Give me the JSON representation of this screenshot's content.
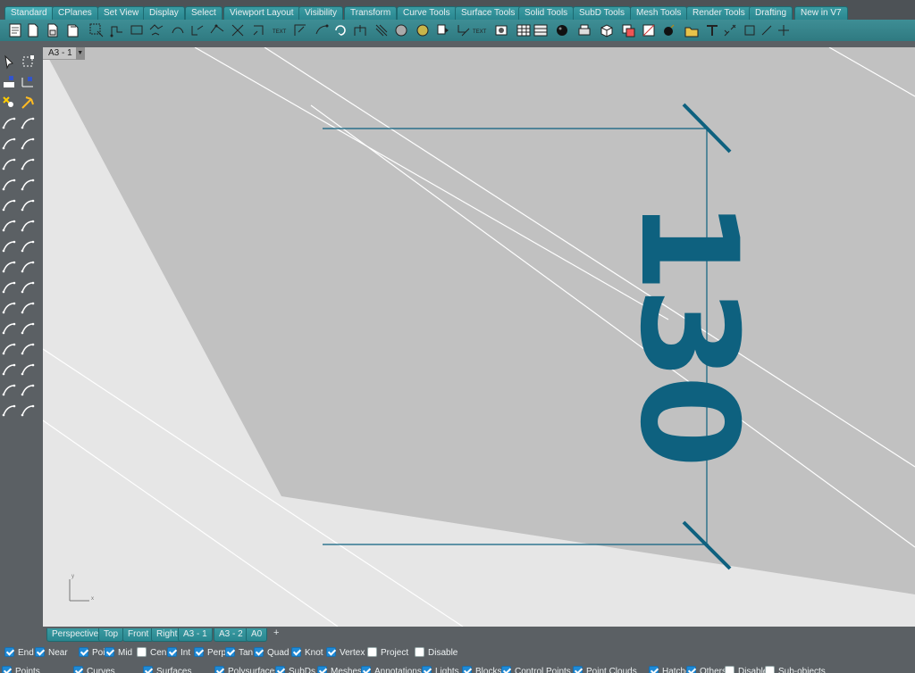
{
  "top_tabs": [
    {
      "label": "Standard",
      "active": true
    },
    {
      "label": "CPlanes"
    },
    {
      "label": "Set View"
    },
    {
      "label": "Display"
    },
    {
      "label": "Select"
    },
    {
      "label": "Viewport Layout"
    },
    {
      "label": "Visibility"
    },
    {
      "label": "Transform"
    },
    {
      "label": "Curve Tools"
    },
    {
      "label": "Surface Tools"
    },
    {
      "label": "Solid Tools"
    },
    {
      "label": "SubD Tools"
    },
    {
      "label": "Mesh Tools"
    },
    {
      "label": "Render Tools"
    },
    {
      "label": "Drafting"
    },
    {
      "label": "New in V7"
    }
  ],
  "toolbar_icons": [
    "new-icon",
    "open-icon",
    "save-icon",
    "save-as-icon",
    "print-icon",
    "select-window-icon",
    "polyline-icon",
    "rectangle-icon",
    "polygon-icon",
    "curve-icon",
    "arc-icon",
    "move-icon",
    "rotate-icon",
    "mirror-icon",
    "array-icon",
    "text-icon",
    "dimension-icon",
    "leader-icon",
    "undo-icon",
    "redo-icon",
    "hatch-icon",
    "layer-icon",
    "properties-icon",
    "trim-icon",
    "split-icon",
    "text-object-icon",
    "snapshot-icon",
    "grid-icon",
    "layer-table-icon",
    "sphere-icon",
    "printer-icon",
    "box-icon",
    "mesh-icon",
    "render-icon",
    "material-icon",
    "bomb-icon",
    "folder-icon",
    "text-dot-icon",
    "transform-icon"
  ],
  "viewport": {
    "title": "A3 - 1",
    "dimension_text": "130",
    "axis_y": "y",
    "axis_x": "x",
    "accent_color": "#0e617f"
  },
  "viewport_tabs": [
    "Perspective",
    "Top",
    "Front",
    "Right",
    "A3 - 1",
    "A3 - 2",
    "A0"
  ],
  "add_tab_label": "+",
  "osnaps": [
    {
      "label": "End",
      "checked": true
    },
    {
      "label": "Near",
      "checked": true
    },
    {
      "label": "Point",
      "checked": true
    },
    {
      "label": "Mid",
      "checked": true
    },
    {
      "label": "Cen",
      "checked": false
    },
    {
      "label": "Int",
      "checked": true
    },
    {
      "label": "Perp",
      "checked": true
    },
    {
      "label": "Tan",
      "checked": true
    },
    {
      "label": "Quad",
      "checked": true
    },
    {
      "label": "Knot",
      "checked": true
    },
    {
      "label": "Vertex",
      "checked": true
    },
    {
      "label": "Project",
      "checked": false
    },
    {
      "label": "Disable",
      "checked": false
    }
  ],
  "filters": [
    {
      "label": "Points",
      "checked": true
    },
    {
      "label": "Curves",
      "checked": true
    },
    {
      "label": "Surfaces",
      "checked": true
    },
    {
      "label": "Polysurfaces",
      "checked": true
    },
    {
      "label": "SubDs",
      "checked": true
    },
    {
      "label": "Meshes",
      "checked": true
    },
    {
      "label": "Annotations",
      "checked": true
    },
    {
      "label": "Lights",
      "checked": true
    },
    {
      "label": "Blocks",
      "checked": true
    },
    {
      "label": "Control Points",
      "checked": true
    },
    {
      "label": "Point Clouds",
      "checked": true
    },
    {
      "label": "Hatches",
      "checked": true
    },
    {
      "label": "Others",
      "checked": true
    },
    {
      "label": "Disable",
      "checked": false
    },
    {
      "label": "Sub-objects",
      "checked": false
    }
  ]
}
